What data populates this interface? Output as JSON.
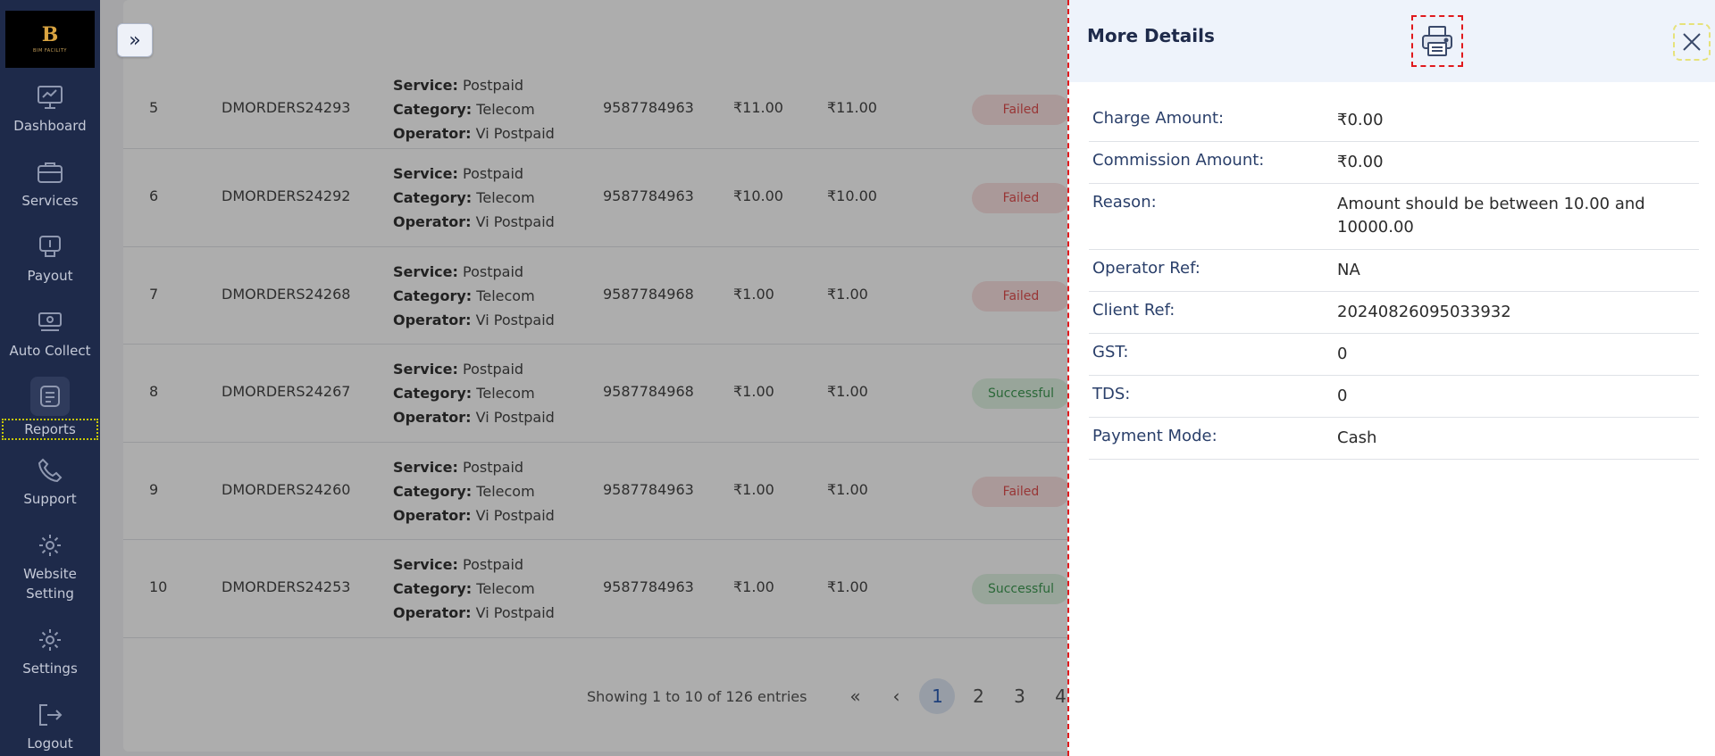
{
  "sidebar": {
    "logo": {
      "mark": "B",
      "sub": "BIM FACILITY"
    },
    "items": [
      {
        "label": "Dashboard",
        "icon": "dashboard-icon"
      },
      {
        "label": "Services",
        "icon": "briefcase-icon"
      },
      {
        "label": "Payout",
        "icon": "payout-icon"
      },
      {
        "label": "Auto Collect",
        "icon": "auto-collect-icon"
      },
      {
        "label": "Reports",
        "icon": "reports-icon"
      },
      {
        "label": "Support",
        "icon": "phone-icon"
      },
      {
        "label": "Website Setting",
        "icon": "gear-icon"
      },
      {
        "label": "Settings",
        "icon": "gear-icon"
      },
      {
        "label": "Logout",
        "icon": "logout-icon"
      }
    ]
  },
  "main": {
    "expand_icon": "»",
    "rows": [
      {
        "index": "5",
        "order_id": "DMORDERS24293",
        "service": "Postpaid",
        "category": "Telecom",
        "operator": "Vi Postpaid",
        "mobile": "9587784963",
        "amount": "₹11.00",
        "net": "₹11.00",
        "status": "Failed"
      },
      {
        "index": "6",
        "order_id": "DMORDERS24292",
        "service": "Postpaid",
        "category": "Telecom",
        "operator": "Vi Postpaid",
        "mobile": "9587784963",
        "amount": "₹10.00",
        "net": "₹10.00",
        "status": "Failed"
      },
      {
        "index": "7",
        "order_id": "DMORDERS24268",
        "service": "Postpaid",
        "category": "Telecom",
        "operator": "Vi Postpaid",
        "mobile": "9587784968",
        "amount": "₹1.00",
        "net": "₹1.00",
        "status": "Failed"
      },
      {
        "index": "8",
        "order_id": "DMORDERS24267",
        "service": "Postpaid",
        "category": "Telecom",
        "operator": "Vi Postpaid",
        "mobile": "9587784968",
        "amount": "₹1.00",
        "net": "₹1.00",
        "status": "Successful"
      },
      {
        "index": "9",
        "order_id": "DMORDERS24260",
        "service": "Postpaid",
        "category": "Telecom",
        "operator": "Vi Postpaid",
        "mobile": "9587784963",
        "amount": "₹1.00",
        "net": "₹1.00",
        "status": "Failed"
      },
      {
        "index": "10",
        "order_id": "DMORDERS24253",
        "service": "Postpaid",
        "category": "Telecom",
        "operator": "Vi Postpaid",
        "mobile": "9587784963",
        "amount": "₹1.00",
        "net": "₹1.00",
        "status": "Successful"
      }
    ],
    "labels": {
      "service": "Service:",
      "category": "Category:",
      "operator": "Operator:"
    },
    "pagination": {
      "info": "Showing 1 to 10 of 126 entries",
      "first": "«",
      "prev": "‹",
      "pages": [
        "1",
        "2",
        "3",
        "4"
      ],
      "current": "1"
    }
  },
  "drawer": {
    "title": "More Details",
    "print_icon": "printer-icon",
    "close_icon": "close-icon",
    "details": [
      {
        "label": "Charge Amount:",
        "value": "₹0.00"
      },
      {
        "label": "Commission Amount:",
        "value": "₹0.00"
      },
      {
        "label": "Reason:",
        "value": "Amount should be between 10.00 and 10000.00"
      },
      {
        "label": "Operator Ref:",
        "value": "NA"
      },
      {
        "label": "Client Ref:",
        "value": "20240826095033932"
      },
      {
        "label": "GST:",
        "value": "0"
      },
      {
        "label": "TDS:",
        "value": "0"
      },
      {
        "label": "Payment Mode:",
        "value": "Cash"
      }
    ]
  },
  "colors": {
    "sidebar_bg": "#1e2a4a",
    "failed": "#e05050",
    "success": "#3f9a53",
    "accent": "#2d5fb6"
  }
}
